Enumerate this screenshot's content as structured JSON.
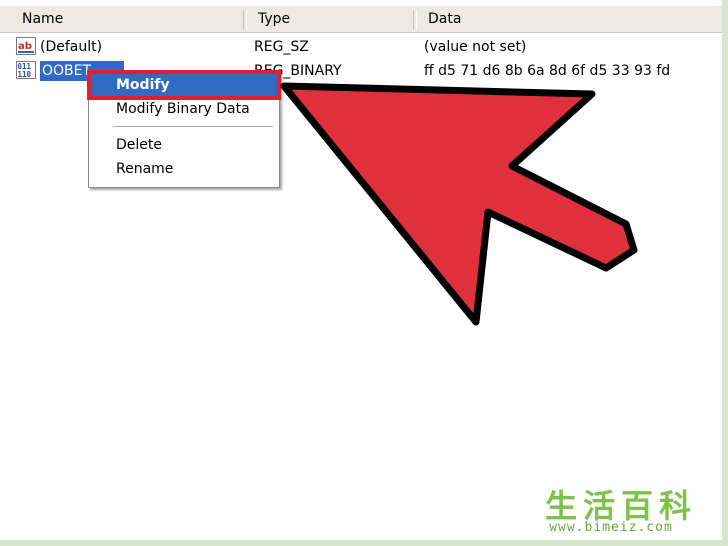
{
  "header": {
    "columns": [
      "Name",
      "Type",
      "Data"
    ]
  },
  "rows": [
    {
      "name": "(Default)",
      "type": "REG_SZ",
      "data": "(value not set)",
      "icon": "string-value-icon"
    },
    {
      "name": "OOBET",
      "type": "REG_BINARY",
      "data": "ff d5 71 d6 8b 6a 8d 6f d5 33 93 fd",
      "icon": "binary-value-icon"
    }
  ],
  "context_menu": {
    "items": [
      "Modify",
      "Modify Binary Data",
      "Delete",
      "Rename"
    ],
    "highlighted": "Modify"
  },
  "annotation": {
    "arrow_color": "#e0303c",
    "highlight_color": "#e0202c"
  },
  "watermark": {
    "logo": "生活百科",
    "url": "www.bimeiz.com"
  }
}
